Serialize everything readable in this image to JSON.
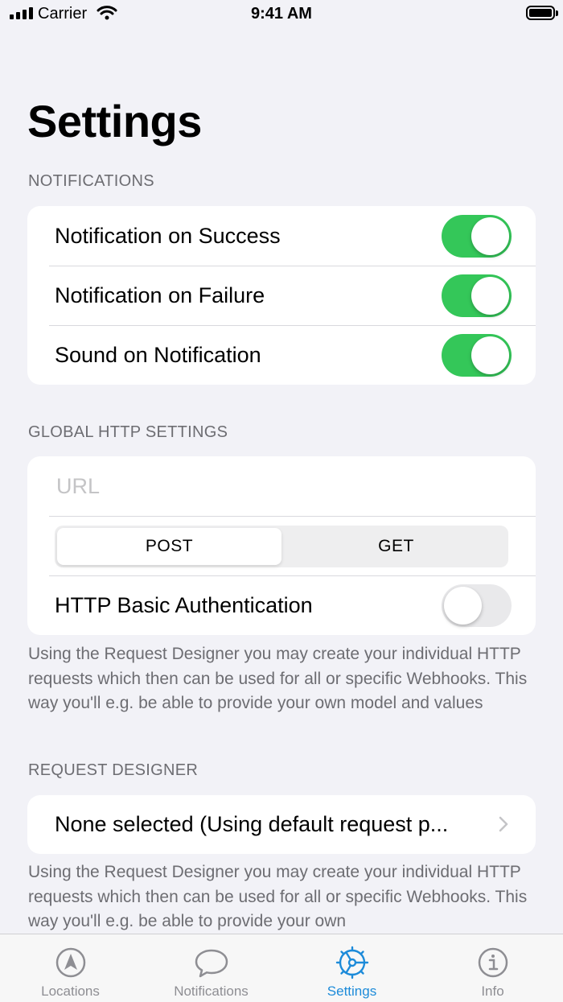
{
  "status_bar": {
    "carrier": "Carrier",
    "time": "9:41 AM"
  },
  "page": {
    "title": "Settings"
  },
  "notifications": {
    "header": "NOTIFICATIONS",
    "rows": [
      {
        "label": "Notification on Success",
        "enabled": true
      },
      {
        "label": "Notification on Failure",
        "enabled": true
      },
      {
        "label": "Sound on Notification",
        "enabled": true
      }
    ]
  },
  "http": {
    "header": "GLOBAL HTTP SETTINGS",
    "url_placeholder": "URL",
    "url_value": "",
    "methods": [
      "POST",
      "GET"
    ],
    "selected_method": "POST",
    "basic_auth_label": "HTTP Basic Authentication",
    "basic_auth_enabled": false,
    "footer": "Using the Request Designer you may create your individual HTTP requests which then can be used for all or specific Webhooks. This way you'll e.g. be able to provide your own model and values"
  },
  "request_designer": {
    "header": "REQUEST DESIGNER",
    "selection": "None selected (Using default request p...",
    "footer": "Using the Request Designer you may create your individual HTTP requests which then can be used for all or specific Webhooks. This way you'll e.g. be able to provide your own"
  },
  "tab_bar": {
    "tabs": [
      {
        "label": "Locations",
        "icon": "location-arrow-icon"
      },
      {
        "label": "Notifications",
        "icon": "speech-bubble-icon"
      },
      {
        "label": "Settings",
        "icon": "settings-gear-icon"
      },
      {
        "label": "Info",
        "icon": "info-circle-icon"
      }
    ],
    "active": "Settings"
  },
  "colors": {
    "background": "#F2F2F7",
    "toggle_on": "#34C759",
    "toggle_off": "#E9E9EB",
    "active_tab": "#1D8BD9",
    "inactive_tab": "#8E8E93",
    "secondary_text": "#6D6D72"
  }
}
